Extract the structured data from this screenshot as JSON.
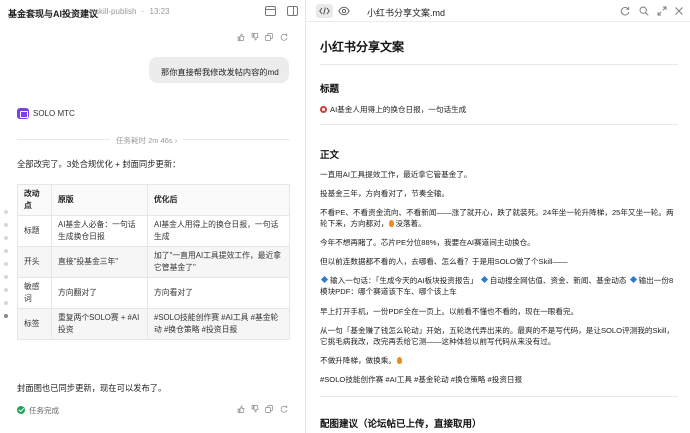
{
  "workspace": {
    "title": "基金套现与AI投资建议",
    "branch": "skill-publish",
    "time": "13:23"
  },
  "chat": {
    "user_message": "那你直接帮我修改发帖内容的md",
    "agent_name": "SOLO MTC",
    "duration": "任务耗时 2m 46s",
    "summary": "全部改完了。3处合规优化 + 封面同步更新：",
    "table": {
      "headers": [
        "改动点",
        "原版",
        "优化后"
      ],
      "rows": [
        [
          "标题",
          "AI基金人必备：一句话生成换仓日报",
          "AI基金人用得上的换仓日报，一句话生成"
        ],
        [
          "开头",
          "直接\"投基金三年\"",
          "加了\"一直用AI工具提效工作，最近拿它管基金了\""
        ],
        [
          "敏感词",
          "方向翻对了",
          "方向看对了"
        ],
        [
          "标签",
          "重复两个SOLO赛 + #AI投资",
          "#SOLO技能创作赛 #AI工具 #基金轮动 #换仓策略 #投资日报"
        ]
      ]
    },
    "footer": "封面图也已同步更新，现在可以发布了。",
    "task_status": "任务完成"
  },
  "preview": {
    "file_name": "小红书分享文案.md",
    "h1": "小红书分享文案",
    "sec_title": "标题",
    "title_line": "AI基金人用得上的换仓日报，一句话生成",
    "sec_body": "正文",
    "body": {
      "p1": "一直用AI工具提效工作，最近拿它管基金了。",
      "p2": "投基金三年，方向看对了，节奏全输。",
      "p3": "不看PE、不看资金流向、不看新闻——涨了就开心，跌了就装死。24年坐一轮升降梯，25年又坐一轮。两轮下来，方向都对，",
      "p3_tail": "没落着。",
      "p4": "今年不想再賭了。芯片PE分位88%，我要在AI赛道间主动换仓。",
      "p5": "但以前连数据都不看的人，去哪看、怎么看？于是用SOLO做了个Skill——",
      "p6a": "输入一句话：「生成今天的AI板块投资报告」",
      "p6b": "自动搜全网估值、资金、新闻、基金动态",
      "p6c": "输出一份8模块PDF：哪个赛道该下车、哪个该上车",
      "p7": "早上打开手机，一份PDF全在一页上。以前看不懂也不看的，现在一眼看完。",
      "p8": "从一句「基金赚了钱怎么轮动」开始，五轮迭代弄出来的。最爽的不是写代码，是让SOLO评测我的Skill，它挑毛病我改，改完再丢给它测——这种体验以前写代码从来没有过。",
      "p9a": "不做升降梯，做换乘。",
      "p10": "#SOLO技能创作赛 #AI工具 #基金轮动 #换仓策略 #投资日报"
    },
    "sec_cover": "配图建议（论坛帖已上传，直接取用）"
  }
}
